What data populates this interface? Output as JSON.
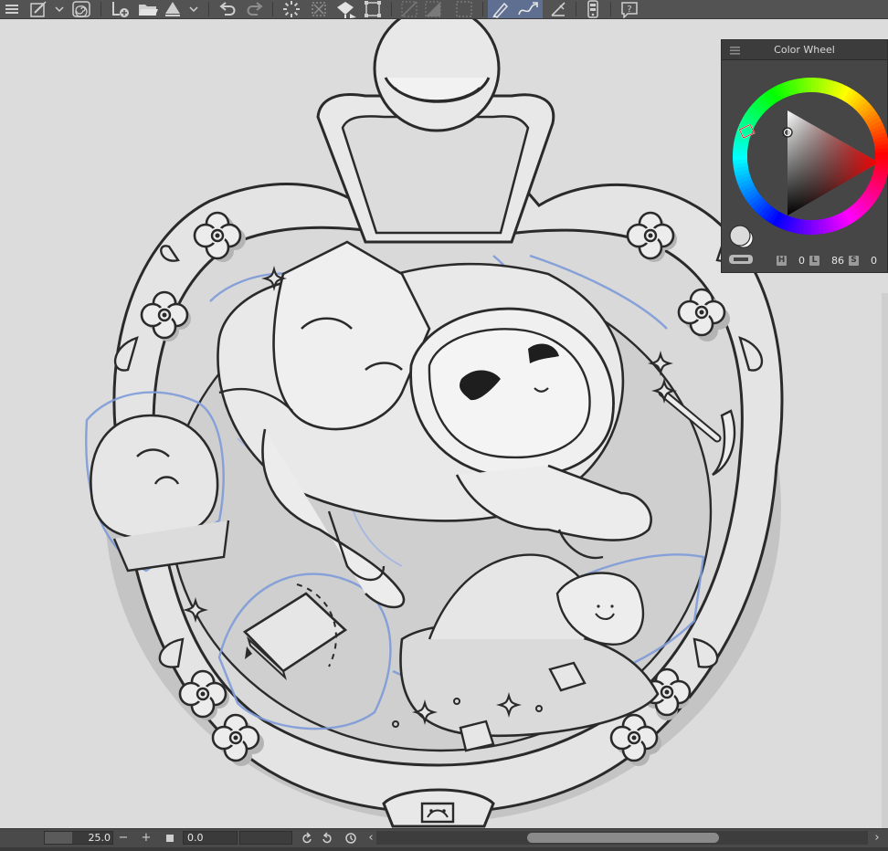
{
  "toolbar": {
    "items": [
      {
        "name": "menu-icon"
      },
      {
        "name": "pen-tool-icon"
      },
      {
        "name": "dropdown-chevron-icon"
      },
      {
        "name": "spiral-icon"
      },
      {
        "name": "new-canvas-icon"
      },
      {
        "name": "open-folder-icon"
      },
      {
        "name": "upload-icon"
      },
      {
        "name": "undo-icon"
      },
      {
        "name": "redo-icon"
      },
      {
        "name": "loading-icon"
      },
      {
        "name": "clear-selection-icon"
      },
      {
        "name": "fill-icon"
      },
      {
        "name": "transform-icon"
      },
      {
        "name": "fill-selection-icon"
      },
      {
        "name": "ruler-snap-icon"
      },
      {
        "name": "eyedropper-icon"
      },
      {
        "name": "stylus-icon"
      },
      {
        "name": "help-icon"
      }
    ],
    "active": [
      "stylus-icon",
      "eyedropper-icon"
    ]
  },
  "color_wheel": {
    "title": "Color Wheel",
    "h_label": "H",
    "h_value": "0",
    "l_label": "L",
    "l_value": "86",
    "s_label": "S",
    "s_value": "0",
    "main_color": "#dbdbdb",
    "sub_color": "#ffffff"
  },
  "statusbar": {
    "zoom_value": "25.0",
    "zoom_minus": "−",
    "zoom_plus": "+",
    "rotation_value": "0.0",
    "scroll_left": "‹",
    "scroll_right": "›"
  },
  "colors": {
    "toolbar_bg": "#535353",
    "canvas_bg": "#dcdcdc",
    "lineart": "#2a2a2a",
    "sketch_blue": "#7d9ad8",
    "panel_bg": "#464646"
  }
}
